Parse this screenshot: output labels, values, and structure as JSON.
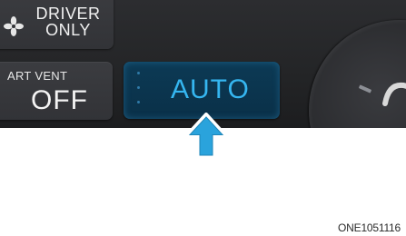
{
  "controls": {
    "driver_only": {
      "label_line1": "DRIVER",
      "label_line2": "ONLY",
      "icon": "fan-icon"
    },
    "smart_vent": {
      "label": "ART VENT",
      "value": "OFF"
    },
    "auto": {
      "label": "AUTO"
    }
  },
  "callout_arrow": {
    "icon": "arrow-up-icon",
    "color": "#2aa3dc"
  },
  "figure_code": "ONE1051116",
  "colors": {
    "panel": "#2a2b2e",
    "auto_bg": "#0c3a55",
    "auto_text": "#35b6f0"
  }
}
